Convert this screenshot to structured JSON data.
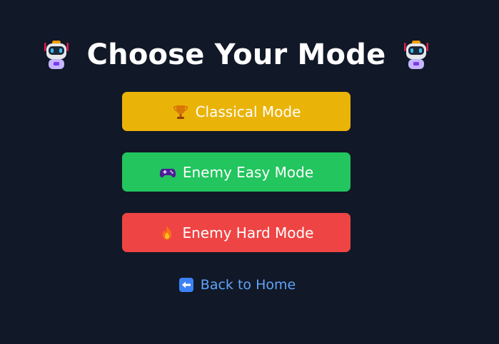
{
  "page": {
    "title": "Choose Your Mode",
    "title_icon": "robot-icon"
  },
  "modes": [
    {
      "label": "Classical Mode",
      "icon": "trophy-icon",
      "color": "#EAB308"
    },
    {
      "label": "Enemy Easy Mode",
      "icon": "gamepad-icon",
      "color": "#22C55E"
    },
    {
      "label": "Enemy Hard Mode",
      "icon": "fire-icon",
      "color": "#EF4444"
    }
  ],
  "back": {
    "label": "Back to Home",
    "icon": "left-arrow-icon",
    "color": "#60A5FA"
  },
  "colors": {
    "background": "#111827",
    "title": "#FFFFFF",
    "button_text": "#FFFFFF"
  }
}
